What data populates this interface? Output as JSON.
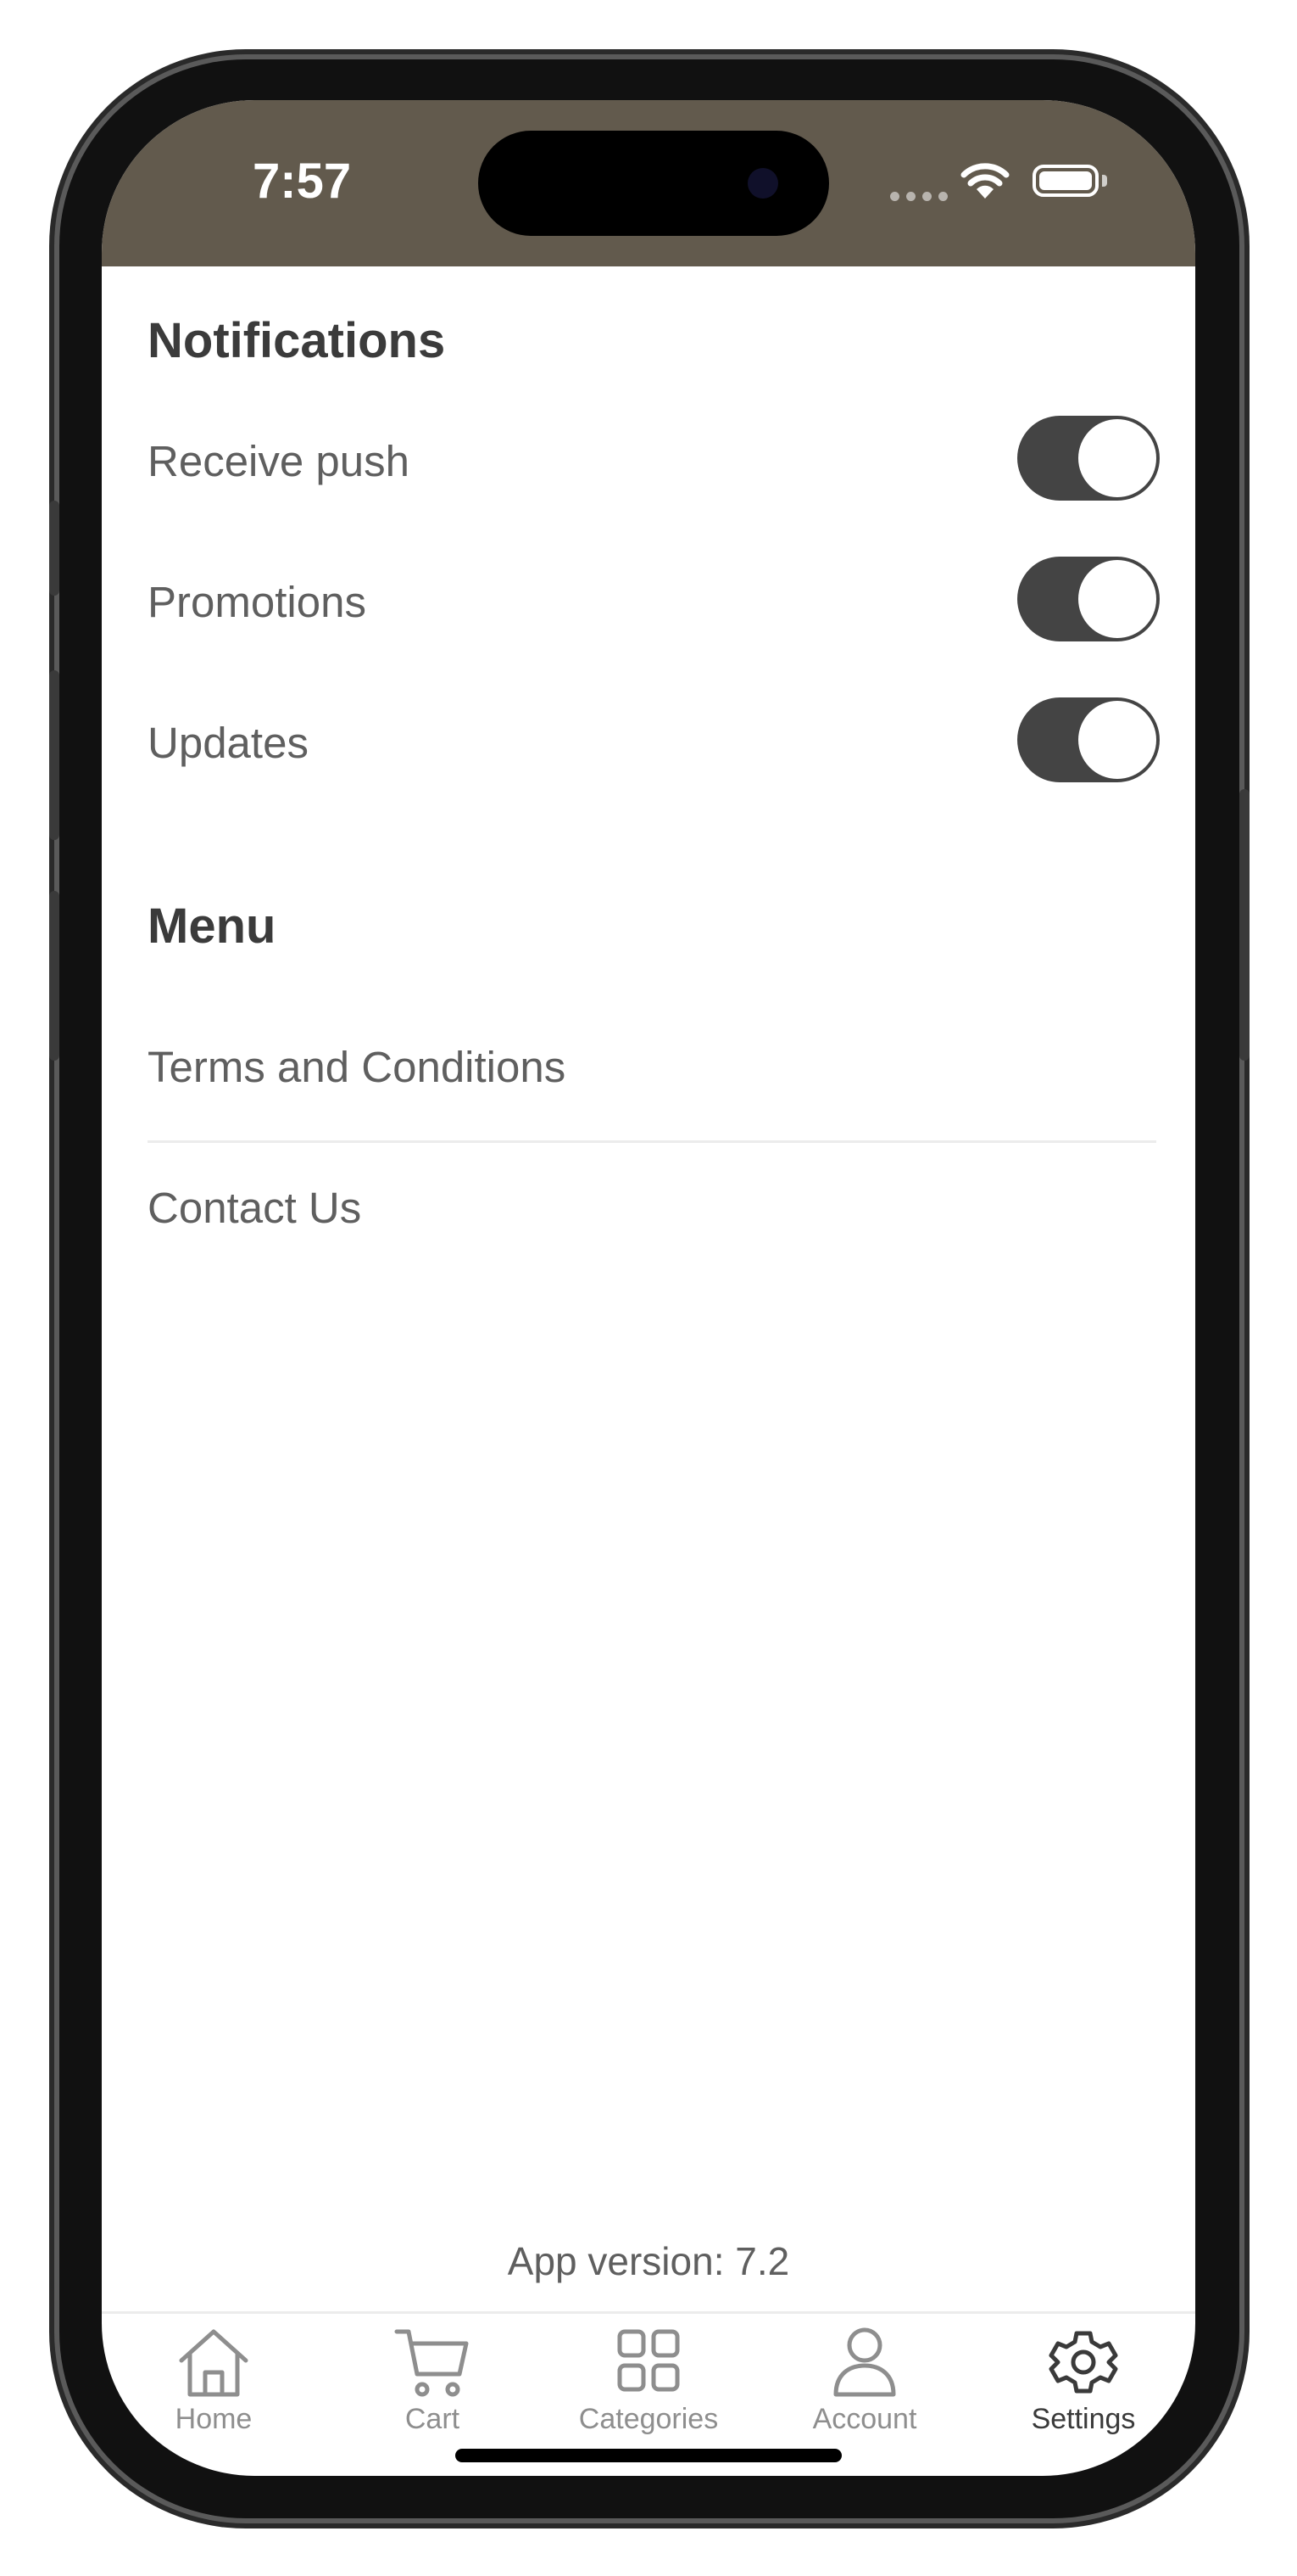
{
  "status_bar": {
    "time": "7:57",
    "background": "#625a4d"
  },
  "notifications": {
    "title": "Notifications",
    "items": [
      {
        "label": "Receive push",
        "on": true
      },
      {
        "label": "Promotions",
        "on": true
      },
      {
        "label": "Updates",
        "on": true
      }
    ]
  },
  "menu": {
    "title": "Menu",
    "items": [
      {
        "label": "Terms and Conditions"
      },
      {
        "label": "Contact Us"
      }
    ]
  },
  "footer": {
    "app_version": "App version: 7.2"
  },
  "tabbar": {
    "items": [
      {
        "label": "Home",
        "icon": "home-icon",
        "active": false
      },
      {
        "label": "Cart",
        "icon": "cart-icon",
        "active": false
      },
      {
        "label": "Categories",
        "icon": "grid-icon",
        "active": false
      },
      {
        "label": "Account",
        "icon": "person-icon",
        "active": false
      },
      {
        "label": "Settings",
        "icon": "gear-icon",
        "active": true
      }
    ]
  },
  "colors": {
    "toggle_on": "#444444",
    "text_primary": "#3b3b3b",
    "text_secondary": "#5f5f5f",
    "tab_inactive": "#8e8e8e"
  }
}
